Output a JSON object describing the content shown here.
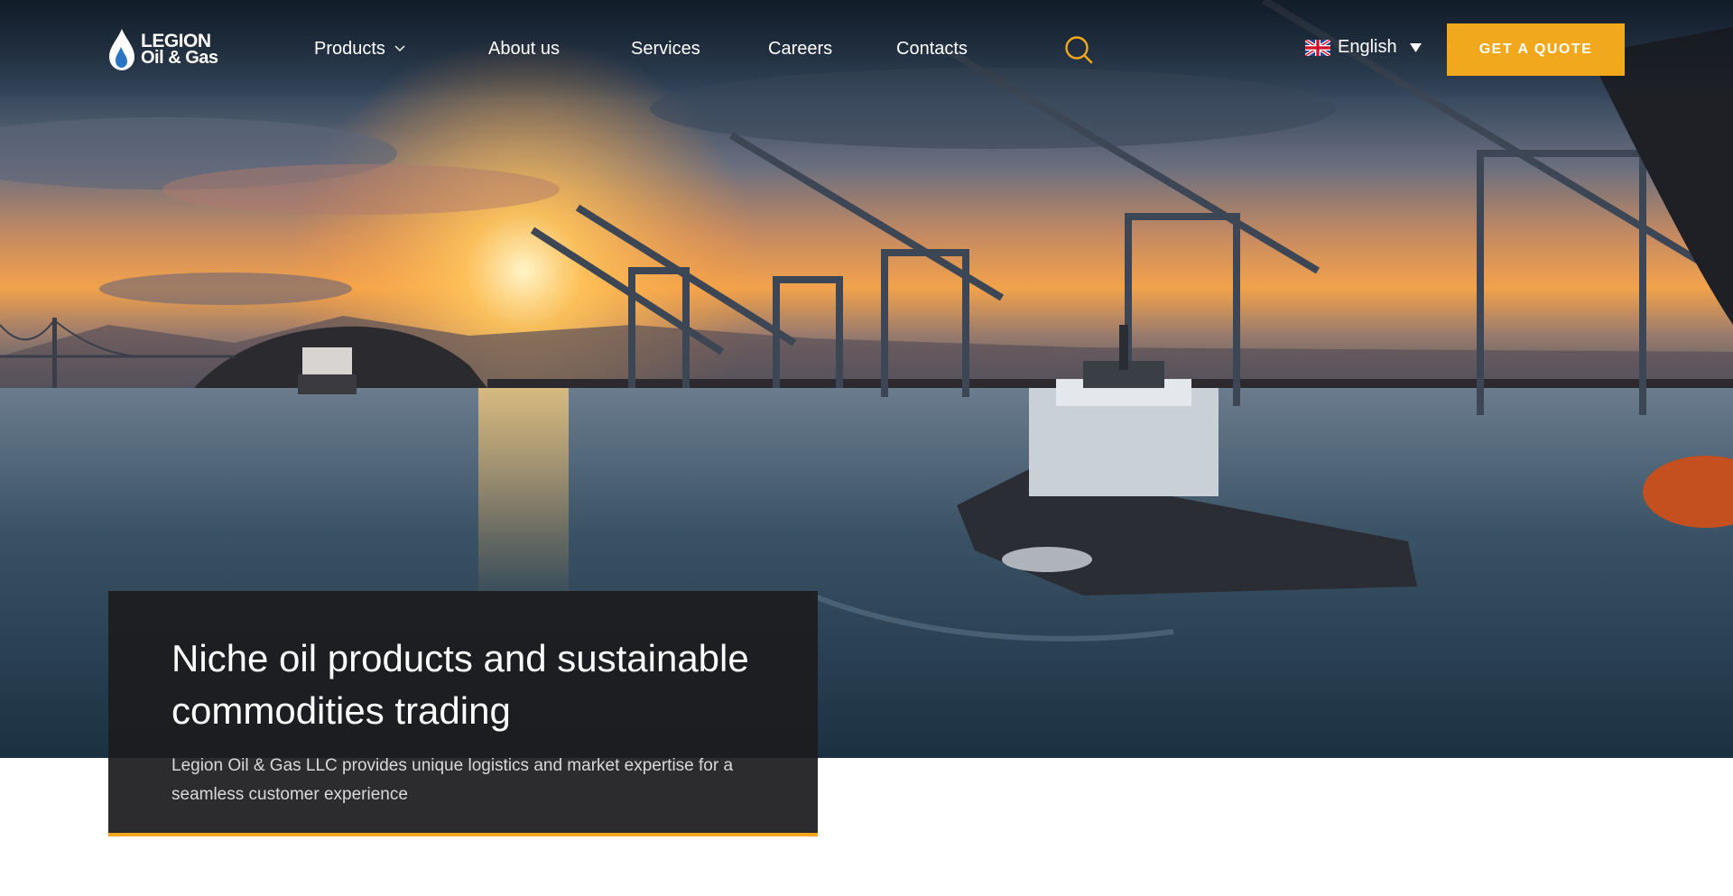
{
  "brand": {
    "logo_line1": "LEGION",
    "logo_line2": "Oil & Gas",
    "accent_color": "#f2a81d"
  },
  "nav": {
    "items": [
      {
        "label": "Products",
        "has_dropdown": true
      },
      {
        "label": "About us"
      },
      {
        "label": "Services"
      },
      {
        "label": "Careers"
      },
      {
        "label": "Contacts"
      }
    ],
    "search_icon": "search-icon",
    "language": {
      "label": "English",
      "flag": "uk-flag-icon"
    },
    "cta_label": "GET A QUOTE"
  },
  "hero": {
    "title": "Niche oil products and sustainable commodities trading",
    "subtitle": "Legion Oil & Gas LLC provides unique logistics and market expertise for a seamless customer experience",
    "image": "harbor-sunset-tugboat"
  }
}
